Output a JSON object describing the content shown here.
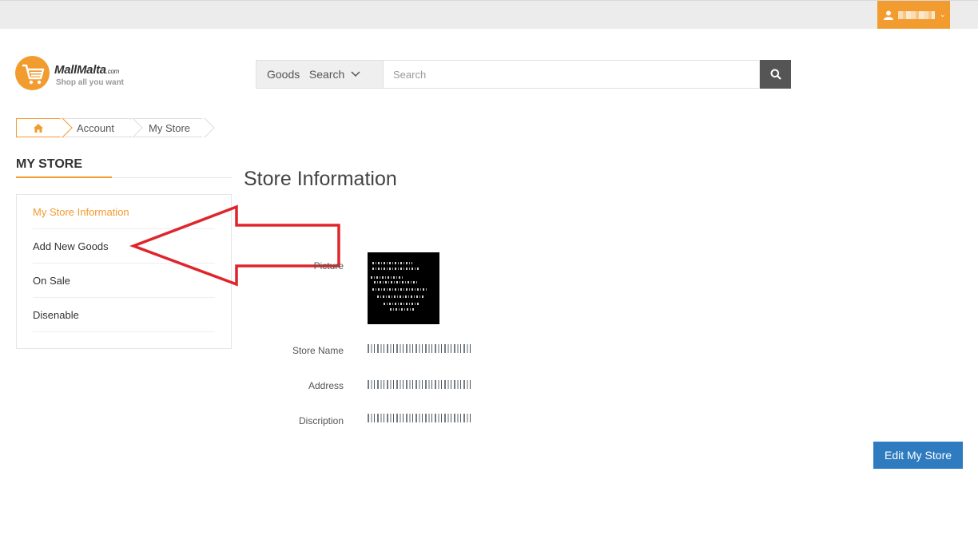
{
  "header": {
    "user_menu": {
      "chevron": "⌄"
    }
  },
  "logo": {
    "brand": "MallMalta",
    "brand_suffix": ".com",
    "tagline": "Shop all you want"
  },
  "search": {
    "category": "Goods   Search",
    "placeholder": "Search",
    "button_icon": "search-icon"
  },
  "breadcrumb": {
    "home_icon": "home-icon",
    "items": [
      "Account",
      "My Store"
    ]
  },
  "sidebar": {
    "title": "MY STORE",
    "items": [
      {
        "label": "My Store Information",
        "active": true
      },
      {
        "label": "Add New Goods",
        "active": false
      },
      {
        "label": "On Sale",
        "active": false
      },
      {
        "label": "Disenable",
        "active": false
      }
    ]
  },
  "main": {
    "title": "Store Information",
    "fields": {
      "picture_label": "Picture",
      "store_name_label": "Store Name",
      "address_label": "Address",
      "description_label": "Discription"
    },
    "edit_button": "Edit My Store"
  },
  "colors": {
    "accent": "#f29b2f",
    "primary_button": "#2f7bbf",
    "annotation_arrow": "#e0242b"
  }
}
